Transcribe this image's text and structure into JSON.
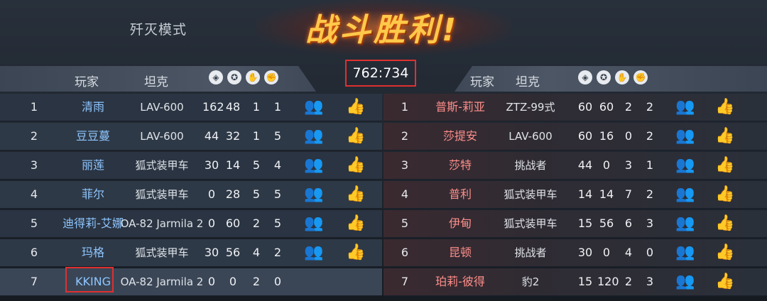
{
  "header": {
    "mode": "歼灭模式",
    "title": "战斗胜利!",
    "score": "762:734",
    "left_cols": {
      "player": "玩家",
      "tank": "坦克"
    },
    "right_cols": {
      "player": "玩家",
      "tank": "坦克"
    },
    "stat_icons": [
      "damage-icon",
      "kill-icon",
      "assist-icon",
      "fist-icon"
    ]
  },
  "left_team": [
    {
      "rank": "1",
      "name": "清雨",
      "tank": "LAV-600",
      "s1": "162",
      "s2": "48",
      "s3": "1",
      "s4": "1"
    },
    {
      "rank": "2",
      "name": "豆豆蔓",
      "tank": "LAV-600",
      "s1": "44",
      "s2": "32",
      "s3": "1",
      "s4": "5"
    },
    {
      "rank": "3",
      "name": "丽莲",
      "tank": "狐式装甲车",
      "s1": "30",
      "s2": "14",
      "s3": "5",
      "s4": "4"
    },
    {
      "rank": "4",
      "name": "菲尔",
      "tank": "狐式装甲车",
      "s1": "0",
      "s2": "28",
      "s3": "5",
      "s4": "5"
    },
    {
      "rank": "5",
      "name": "迪得莉-艾娜",
      "tank": "OA-82 Jarmila 2",
      "s1": "0",
      "s2": "60",
      "s3": "2",
      "s4": "5"
    },
    {
      "rank": "6",
      "name": "玛格",
      "tank": "狐式装甲车",
      "s1": "30",
      "s2": "56",
      "s3": "4",
      "s4": "2"
    },
    {
      "rank": "7",
      "name": "KKING",
      "tank": "OA-82 Jarmila 2",
      "s1": "0",
      "s2": "0",
      "s3": "2",
      "s4": "0"
    }
  ],
  "right_team": [
    {
      "rank": "1",
      "name": "普斯-莉亚",
      "tank": "ZTZ-99式",
      "s1": "60",
      "s2": "60",
      "s3": "2",
      "s4": "2"
    },
    {
      "rank": "2",
      "name": "莎提安",
      "tank": "LAV-600",
      "s1": "60",
      "s2": "16",
      "s3": "0",
      "s4": "2"
    },
    {
      "rank": "3",
      "name": "莎特",
      "tank": "挑战者",
      "s1": "44",
      "s2": "0",
      "s3": "3",
      "s4": "1"
    },
    {
      "rank": "4",
      "name": "普利",
      "tank": "狐式装甲车",
      "s1": "14",
      "s2": "14",
      "s3": "7",
      "s4": "2"
    },
    {
      "rank": "5",
      "name": "伊甸",
      "tank": "狐式装甲车",
      "s1": "15",
      "s2": "56",
      "s3": "6",
      "s4": "3"
    },
    {
      "rank": "6",
      "name": "昆顿",
      "tank": "挑战者",
      "s1": "30",
      "s2": "0",
      "s3": "4",
      "s4": "0"
    },
    {
      "rank": "7",
      "name": "珀莉-彼得",
      "tank": "豹2",
      "s1": "15",
      "s2": "120",
      "s3": "2",
      "s4": "3"
    }
  ]
}
